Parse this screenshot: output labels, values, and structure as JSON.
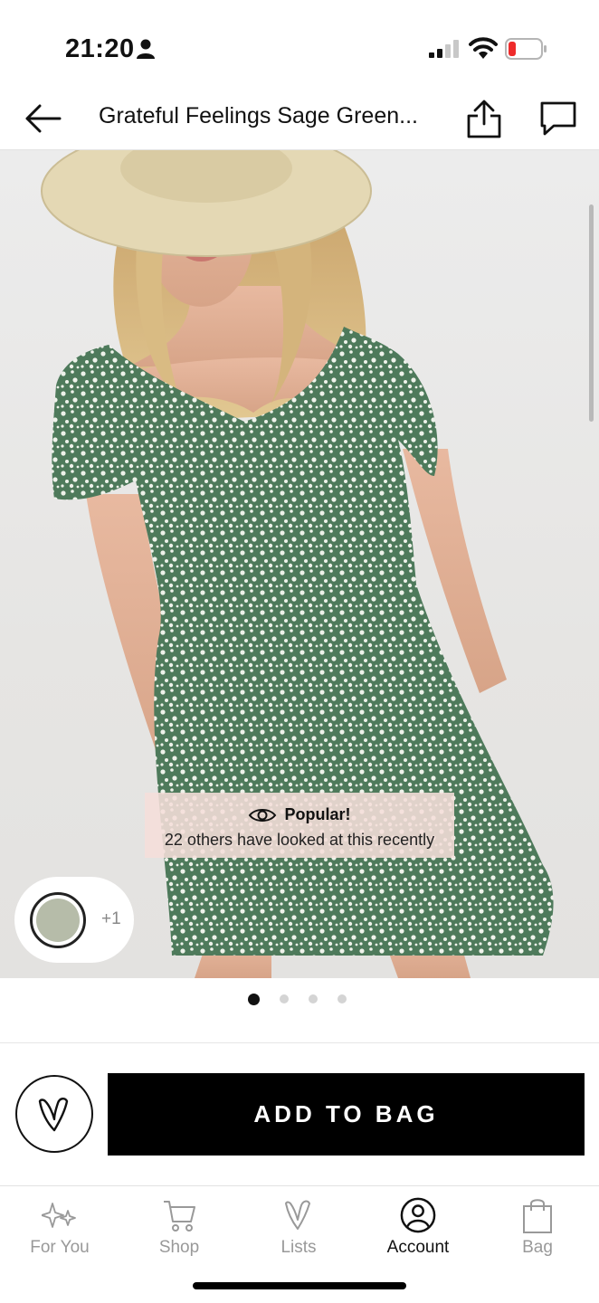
{
  "status_bar": {
    "time": "21:20"
  },
  "header": {
    "title": "Grateful Feelings Sage Green..."
  },
  "product": {
    "popular_title": "Popular!",
    "popular_subtitle": "22 others have looked at this recently",
    "swatch_color": "#b6bca9",
    "swatch_more": "+1",
    "image_count": 4,
    "active_image": 1
  },
  "actions": {
    "add_to_bag": "ADD TO BAG"
  },
  "tabbar": {
    "items": [
      {
        "label": "For You",
        "icon": "sparkles-icon"
      },
      {
        "label": "Shop",
        "icon": "cart-icon"
      },
      {
        "label": "Lists",
        "icon": "heart-v-icon"
      },
      {
        "label": "Account",
        "icon": "account-icon",
        "active": true
      },
      {
        "label": "Bag",
        "icon": "bag-icon"
      }
    ]
  },
  "colors": {
    "accent": "#000000",
    "badge_bg": "#f5ded9",
    "dress_green": "#4e7a5b"
  }
}
